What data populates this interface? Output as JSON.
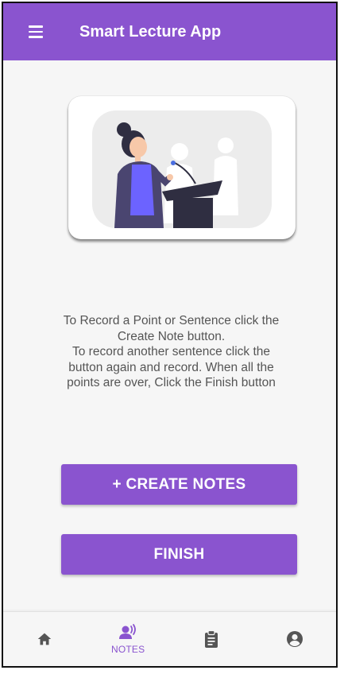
{
  "app": {
    "title": "Smart Lecture App"
  },
  "instructions": {
    "lines": [
      "To Record a Point or Sentence click the",
      "Create Note button.",
      "To record another sentence click the",
      "button again and record. When all the",
      "points are over, Click the Finish button"
    ]
  },
  "buttons": {
    "create_notes": "+ CREATE NOTES",
    "finish": "FINISH"
  },
  "bottom_nav": {
    "items": [
      {
        "icon": "home-icon",
        "label": ""
      },
      {
        "icon": "record-voice-icon",
        "label": "NOTES",
        "active": true
      },
      {
        "icon": "clipboard-icon",
        "label": ""
      },
      {
        "icon": "account-circle-icon",
        "label": ""
      }
    ]
  },
  "colors": {
    "primary": "#8a54cf",
    "background": "#f6f6f6",
    "text": "#555555",
    "icon_inactive": "#555555"
  }
}
